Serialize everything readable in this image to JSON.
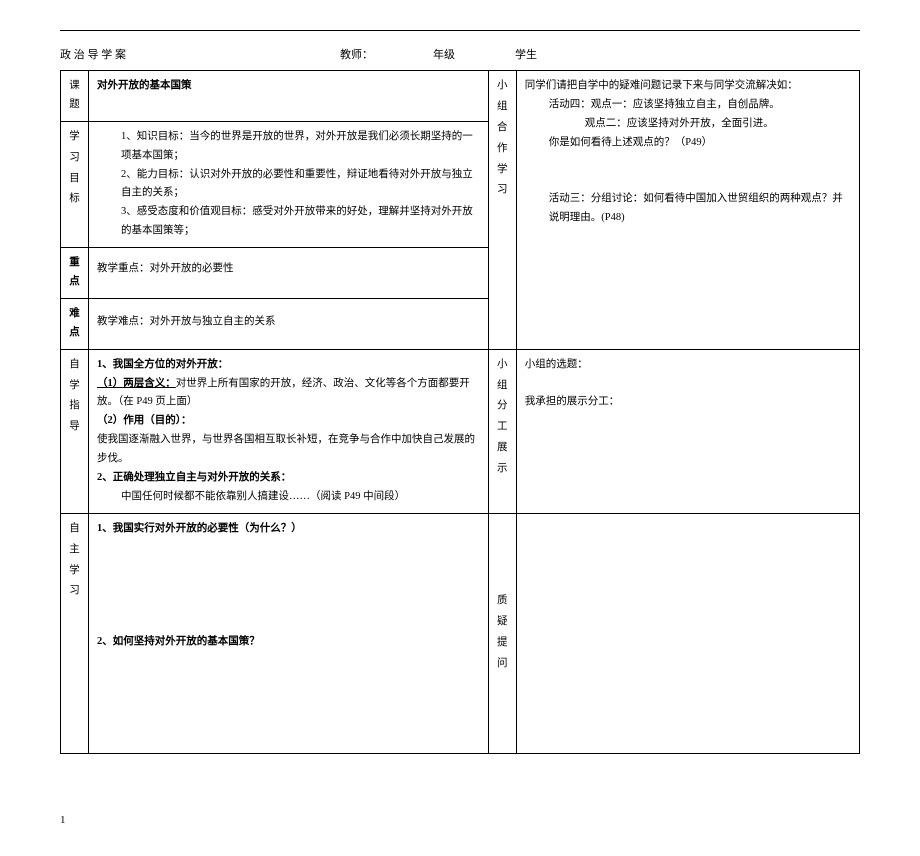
{
  "header": {
    "title": "政 治 导 学 案",
    "teacher_label": "教师：",
    "grade_label": "年级",
    "student_label": "学生"
  },
  "row_keti": {
    "label": "课题",
    "value": "对外开放的基本国策"
  },
  "row_mubiao": {
    "label1": "学",
    "label2": "习",
    "label3": "目",
    "label4": "标",
    "item1": "1、知识目标：当今的世界是开放的世界，对外开放是我们必须长期坚持的一项基本国策；",
    "item2": "2、能力目标：认识对外开放的必要性和重要性，辩证地看待对外开放与独立自主的关系；",
    "item3": "3、感受态度和价值观目标：感受对外开放带来的好处，理解并坚持对外开放的基本国策等；"
  },
  "row_zhongdian": {
    "label": "重点",
    "value": "教学重点：对外开放的必要性"
  },
  "row_nandian": {
    "label": "难点",
    "value": "教学难点：对外开放与独立自主的关系"
  },
  "row_zixue": {
    "label1": "自",
    "label2": "学",
    "label3": "指",
    "label4": "导",
    "h1": "1、我国全方位的对外开放：",
    "p1a": "（1）两层含义：",
    "p1b": "对世界上所有国家的开放，经济、政治、文化等各个方面都要开放。（在 P49 页上面）",
    "p2": "（2）作用（目的）：",
    "p3": "使我国逐渐融入世界，与世界各国相互取长补短，在竞争与合作中加快自己发展的步伐。",
    "h2": "2、正确处理独立自主与对外开放的关系：",
    "p4": "中国任何时候都不能依靠别人搞建设……（阅读 P49 中间段）"
  },
  "row_zizhu": {
    "label1": "自",
    "label2": "主",
    "label3": "学",
    "label4": "习",
    "q1": "1、我国实行对外开放的必要性（为什么？）",
    "q2": "2、如何坚持对外开放的基本国策？"
  },
  "right1": {
    "label1": "小",
    "label2": "组",
    "label3": "合",
    "label4": "作",
    "label5": "学",
    "label6": "习",
    "line1": "同学们请把自学中的疑难问题记录下来与同学交流解决如：",
    "line2": "活动四：观点一：应该坚持独立自主，自创品牌。",
    "line3": "观点二：应该坚持对外开放，全面引进。",
    "line4": "你是如何看待上述观点的？（P49）",
    "line5": "活动三：分组讨论：如何看待中国加入世贸组织的两种观点？并说明理由。(P48)"
  },
  "right2": {
    "label1": "小",
    "label2": "组",
    "label3": "分",
    "label4": "工",
    "label5": "展",
    "label6": "示",
    "line1": "小组的选题：",
    "line2": "我承担的展示分工："
  },
  "right3": {
    "label1": "质",
    "label2": "疑",
    "label3": "提",
    "label4": "问"
  },
  "page_number": "1"
}
